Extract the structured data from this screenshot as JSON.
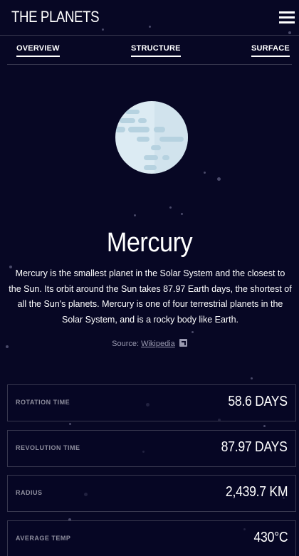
{
  "header": {
    "logo": "THE PLANETS",
    "menu_icon": "hamburger-menu-icon"
  },
  "tabs": [
    {
      "label": "OVERVIEW"
    },
    {
      "label": "STRUCTURE"
    },
    {
      "label": "SURFACE"
    }
  ],
  "planet": {
    "name": "Mercury",
    "description": "Mercury is the smallest planet in the Solar System and the closest to the Sun. Its orbit around the Sun takes 87.97 Earth days, the shortest of all the Sun's planets. Mercury is one of four terrestrial planets in the Solar System, and is a rocky body like Earth.",
    "source_prefix": "Source:",
    "source_link": "Wikipedia",
    "source_icon": "external-link-icon"
  },
  "stats": [
    {
      "label": "ROTATION TIME",
      "value": "58.6 DAYS"
    },
    {
      "label": "REVOLUTION TIME",
      "value": "87.97 DAYS"
    },
    {
      "label": "RADIUS",
      "value": "2,439.7 KM"
    },
    {
      "label": "AVERAGE TEMP",
      "value": "430°C"
    }
  ],
  "colors": {
    "background": "#070724",
    "border": "#38384f",
    "planet": "#dcebf3",
    "planet_shade": "#b6d2e0"
  }
}
